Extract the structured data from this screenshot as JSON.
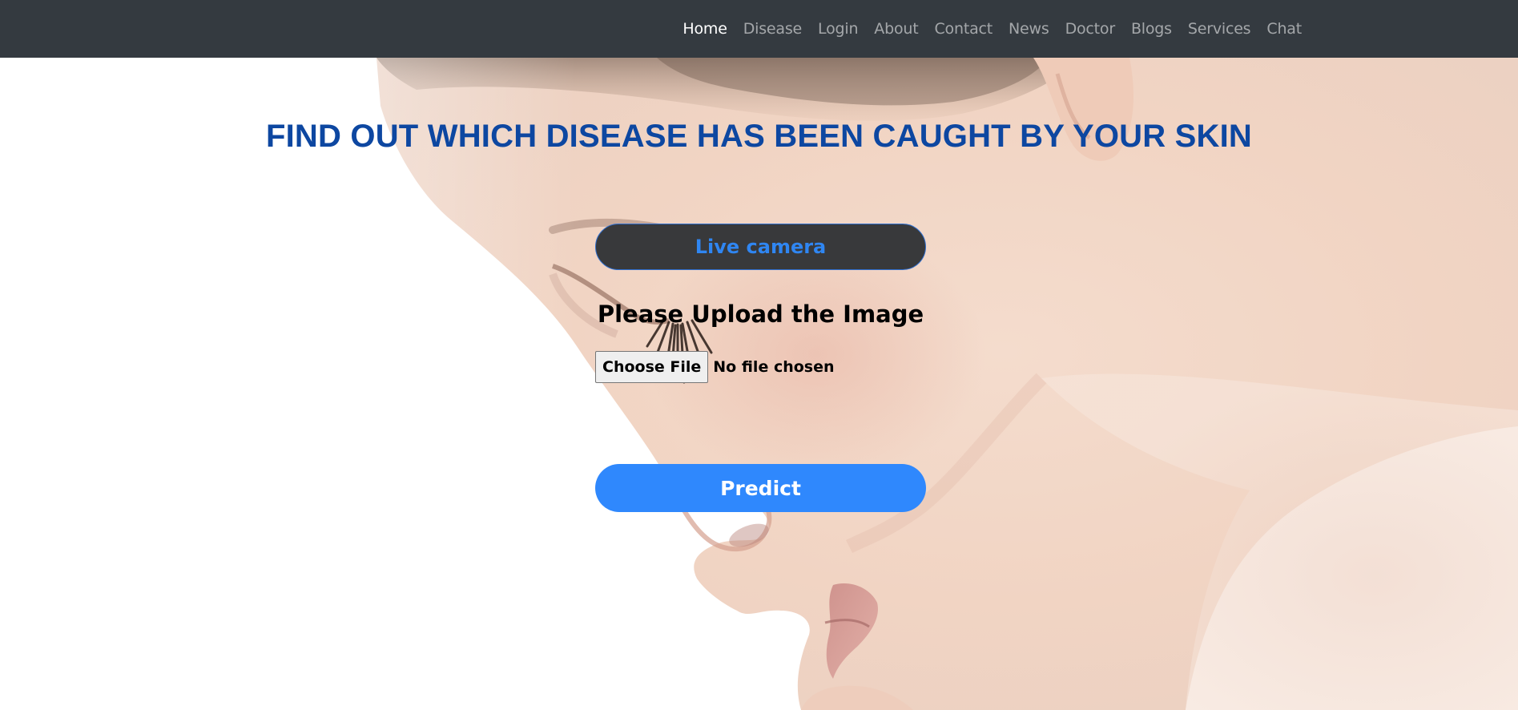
{
  "nav": {
    "items": [
      {
        "label": "Home",
        "active": true
      },
      {
        "label": "Disease",
        "active": false
      },
      {
        "label": "Login",
        "active": false
      },
      {
        "label": "About",
        "active": false
      },
      {
        "label": "Contact",
        "active": false
      },
      {
        "label": "News",
        "active": false
      },
      {
        "label": "Doctor",
        "active": false
      },
      {
        "label": "Blogs",
        "active": false
      },
      {
        "label": "Services",
        "active": false
      },
      {
        "label": "Chat",
        "active": false
      }
    ]
  },
  "main": {
    "headline": "FIND OUT WHICH DISEASE HAS BEEN CAUGHT BY YOUR SKIN",
    "live_camera_label": "Live camera",
    "upload_heading": "Please Upload the Image",
    "choose_file_label": "Choose File",
    "file_status": "No file chosen",
    "predict_label": "Predict"
  },
  "colors": {
    "navbar_bg": "#343a40",
    "headline": "#0d47a1",
    "live_camera_text": "#2f86f2",
    "live_camera_bg": "#38393b",
    "predict_bg": "#2f88fd"
  },
  "background_image": "face-profile-photo"
}
